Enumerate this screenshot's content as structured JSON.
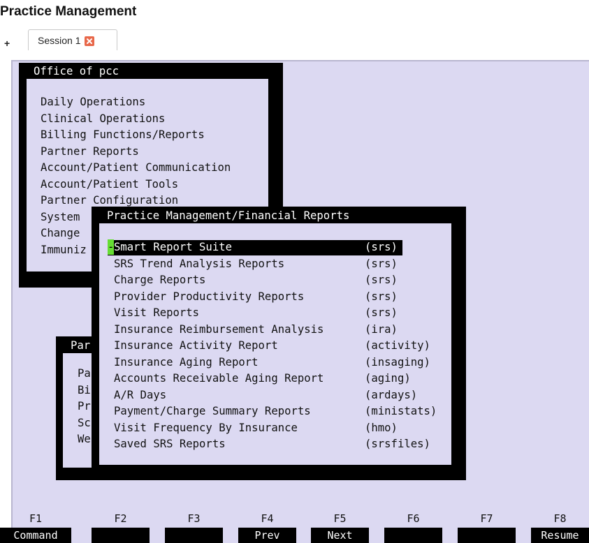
{
  "app": {
    "title": "Practice Management"
  },
  "tabs": {
    "add_label": "+",
    "session_label": "Session 1"
  },
  "office_menu": {
    "title": "Office of pcc",
    "items": [
      "Daily Operations",
      "Clinical Operations",
      "Billing Functions/Reports",
      "Partner Reports",
      "Account/Patient Communication",
      "Account/Patient Tools",
      "Partner Configuration",
      "System",
      "Change",
      "Immuniz"
    ]
  },
  "partner_menu": {
    "title": "Par",
    "items": [
      "Pa",
      "Bi",
      "Pr",
      "Sc",
      "We"
    ]
  },
  "financial_menu": {
    "title": "Practice Management/Financial Reports",
    "items": [
      {
        "label": "Smart Report Suite",
        "code": "(srs)"
      },
      {
        "label": "SRS Trend Analysis Reports",
        "code": "(srs)"
      },
      {
        "label": "Charge Reports",
        "code": "(srs)"
      },
      {
        "label": "Provider Productivity Reports",
        "code": "(srs)"
      },
      {
        "label": "Visit Reports",
        "code": "(srs)"
      },
      {
        "label": "Insurance Reimbursement Analysis",
        "code": "(ira)"
      },
      {
        "label": "Insurance Activity Report",
        "code": "(activity)"
      },
      {
        "label": "Insurance Aging Report",
        "code": "(insaging)"
      },
      {
        "label": "Accounts Receivable Aging Report",
        "code": "(aging)"
      },
      {
        "label": "A/R Days",
        "code": "(ardays)"
      },
      {
        "label": "Payment/Charge Summary Reports",
        "code": "(ministats)"
      },
      {
        "label": "Visit Frequency By Insurance",
        "code": "(hmo)"
      },
      {
        "label": "Saved SRS Reports",
        "code": "(srsfiles)"
      }
    ],
    "selected_marker": "-"
  },
  "function_keys": [
    {
      "key": "F1",
      "label": "Command"
    },
    {
      "key": "F2",
      "label": ""
    },
    {
      "key": "F3",
      "label": ""
    },
    {
      "key": "F4",
      "label": "Prev"
    },
    {
      "key": "F5",
      "label": "Next"
    },
    {
      "key": "F6",
      "label": ""
    },
    {
      "key": "F7",
      "label": ""
    },
    {
      "key": "F8",
      "label": "Resume"
    }
  ],
  "colors": {
    "terminal_bg": "#dcd9f2",
    "frame": "#000000",
    "selection_marker": "#66dd33",
    "close_icon": "#e8684a"
  }
}
